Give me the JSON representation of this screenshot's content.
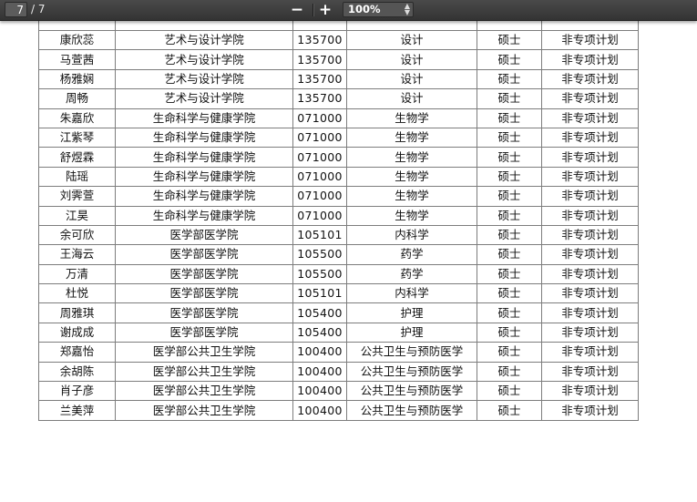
{
  "toolbar": {
    "page_current": "7",
    "page_total": "/ 7",
    "zoom_out_icon": "minus-icon",
    "zoom_in_icon": "plus-icon",
    "zoom_level": "100%"
  },
  "table": {
    "rows": [
      [
        "康欣蕊",
        "艺术与设计学院",
        "135700",
        "设计",
        "硕士",
        "非专项计划"
      ],
      [
        "马萱茜",
        "艺术与设计学院",
        "135700",
        "设计",
        "硕士",
        "非专项计划"
      ],
      [
        "杨雅娴",
        "艺术与设计学院",
        "135700",
        "设计",
        "硕士",
        "非专项计划"
      ],
      [
        "周畅",
        "艺术与设计学院",
        "135700",
        "设计",
        "硕士",
        "非专项计划"
      ],
      [
        "朱嘉欣",
        "生命科学与健康学院",
        "071000",
        "生物学",
        "硕士",
        "非专项计划"
      ],
      [
        "江紫琴",
        "生命科学与健康学院",
        "071000",
        "生物学",
        "硕士",
        "非专项计划"
      ],
      [
        "舒煜霖",
        "生命科学与健康学院",
        "071000",
        "生物学",
        "硕士",
        "非专项计划"
      ],
      [
        "陆瑶",
        "生命科学与健康学院",
        "071000",
        "生物学",
        "硕士",
        "非专项计划"
      ],
      [
        "刘霁萱",
        "生命科学与健康学院",
        "071000",
        "生物学",
        "硕士",
        "非专项计划"
      ],
      [
        "江昊",
        "生命科学与健康学院",
        "071000",
        "生物学",
        "硕士",
        "非专项计划"
      ],
      [
        "余可欣",
        "医学部医学院",
        "105101",
        "内科学",
        "硕士",
        "非专项计划"
      ],
      [
        "王海云",
        "医学部医学院",
        "105500",
        "药学",
        "硕士",
        "非专项计划"
      ],
      [
        "万清",
        "医学部医学院",
        "105500",
        "药学",
        "硕士",
        "非专项计划"
      ],
      [
        "杜悦",
        "医学部医学院",
        "105101",
        "内科学",
        "硕士",
        "非专项计划"
      ],
      [
        "周雅琪",
        "医学部医学院",
        "105400",
        "护理",
        "硕士",
        "非专项计划"
      ],
      [
        "谢成成",
        "医学部医学院",
        "105400",
        "护理",
        "硕士",
        "非专项计划"
      ],
      [
        "郑嘉怡",
        "医学部公共卫生学院",
        "100400",
        "公共卫生与预防医学",
        "硕士",
        "非专项计划"
      ],
      [
        "余胡陈",
        "医学部公共卫生学院",
        "100400",
        "公共卫生与预防医学",
        "硕士",
        "非专项计划"
      ],
      [
        "肖子彦",
        "医学部公共卫生学院",
        "100400",
        "公共卫生与预防医学",
        "硕士",
        "非专项计划"
      ],
      [
        "兰美萍",
        "医学部公共卫生学院",
        "100400",
        "公共卫生与预防医学",
        "硕士",
        "非专项计划"
      ]
    ]
  }
}
